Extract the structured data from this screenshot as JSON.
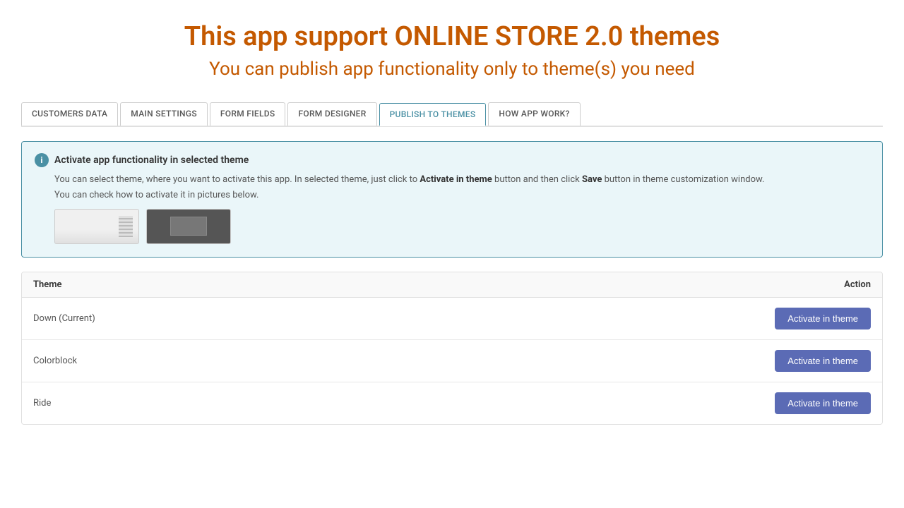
{
  "header": {
    "title": "This app support ONLINE STORE 2.0 themes",
    "subtitle": "You can publish app functionality only to theme(s) you need"
  },
  "tabs": [
    {
      "id": "customers-data",
      "label": "CUSTOMERS DATA",
      "active": false
    },
    {
      "id": "main-settings",
      "label": "MAIN SETTINGS",
      "active": false
    },
    {
      "id": "form-fields",
      "label": "FORM FIELDS",
      "active": false
    },
    {
      "id": "form-designer",
      "label": "FORM DESIGNER",
      "active": false
    },
    {
      "id": "publish-to-themes",
      "label": "PUBLISH TO THEMES",
      "active": true
    },
    {
      "id": "how-app-work",
      "label": "HOW APP WORK?",
      "active": false
    }
  ],
  "info_box": {
    "title": "Activate app functionality in selected theme",
    "text_part1": "You can select theme, where you want to activate this app. In selected theme, just click to ",
    "text_bold1": "Activate in theme",
    "text_part2": " button and then click ",
    "text_bold2": "Save",
    "text_part3": " button in theme customization window.",
    "text_line2": "You can check how to activate it in pictures below."
  },
  "table": {
    "columns": {
      "theme": "Theme",
      "action": "Action"
    },
    "rows": [
      {
        "id": "row-1",
        "name": "Down (Current)",
        "button_label": "Activate in theme"
      },
      {
        "id": "row-2",
        "name": "Colorblock",
        "button_label": "Activate in theme"
      },
      {
        "id": "row-3",
        "name": "Ride",
        "button_label": "Activate in theme"
      }
    ]
  },
  "icons": {
    "info": "i"
  }
}
